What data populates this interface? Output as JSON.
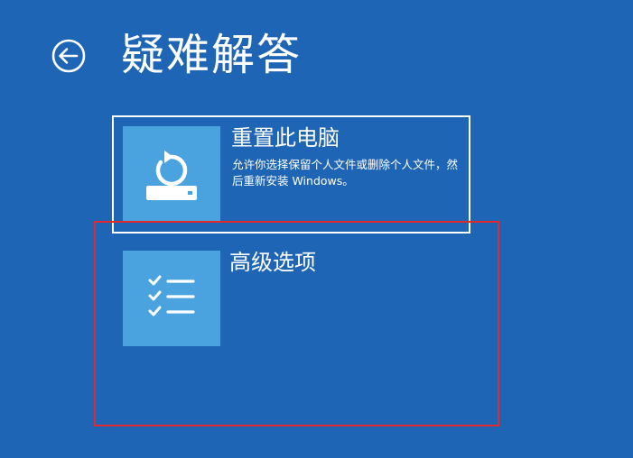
{
  "page": {
    "title": "疑难解答"
  },
  "options": [
    {
      "title": "重置此电脑",
      "description": "允许你选择保留个人文件或删除个人文件，然后重新安装 Windows。",
      "icon": "reset-pc-icon",
      "selected": true
    },
    {
      "title": "高级选项",
      "description": "",
      "icon": "checklist-icon",
      "selected": false
    }
  ],
  "icons": {
    "back": "back-arrow-icon"
  },
  "colors": {
    "background": "#1f65b5",
    "tile": "#4aa3df",
    "text": "#ffffff",
    "highlight": "#e02a2f"
  }
}
